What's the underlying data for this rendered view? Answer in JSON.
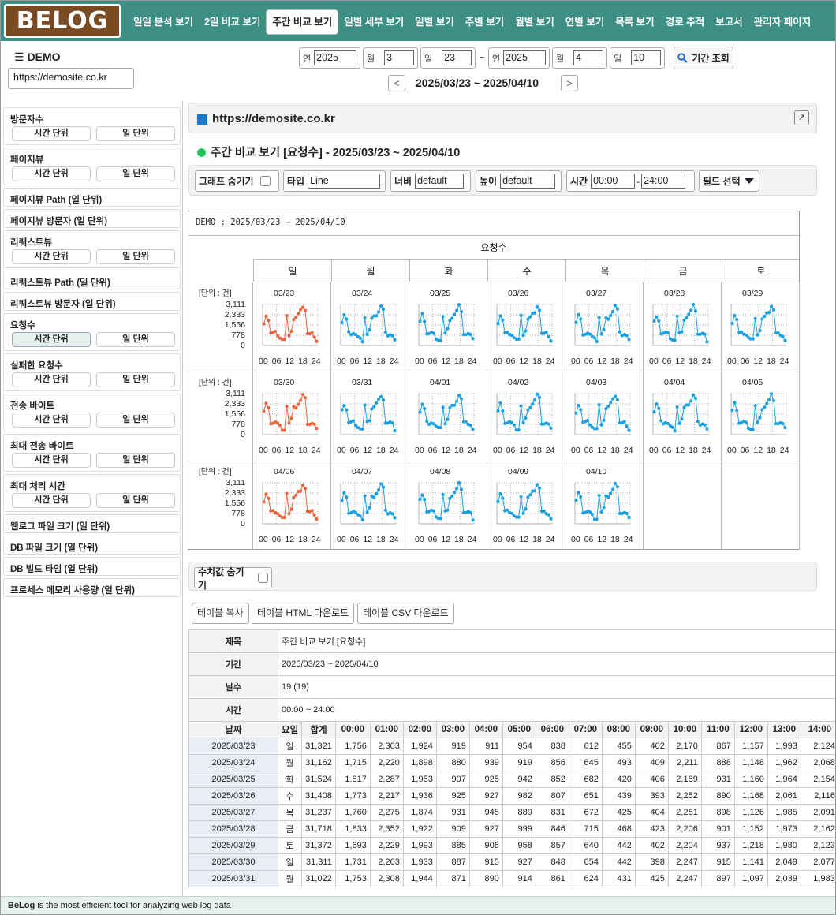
{
  "logo": "BELOG",
  "nav": [
    "일일 분석 보기",
    "2일 비교 보기",
    "주간 비교 보기",
    "일별 세부 보기",
    "일별 보기",
    "주별 보기",
    "월별 보기",
    "연별 보기",
    "목록 보기",
    "경로 추적",
    "보고서",
    "관리자 페이지"
  ],
  "nav_active_index": 2,
  "site": {
    "name": "DEMO",
    "url": "https://demosite.co.kr"
  },
  "date_controls": {
    "from": {
      "year_label": "연",
      "year": "2025",
      "month_label": "월",
      "month": "3",
      "day_label": "일",
      "day": "23"
    },
    "sep": "~",
    "to": {
      "year_label": "연",
      "year": "2025",
      "month_label": "월",
      "month": "4",
      "day_label": "일",
      "day": "10"
    },
    "query_label": "기간 조회",
    "range_text": "2025/03/23 ~ 2025/04/10",
    "prev": "<",
    "next": ">"
  },
  "sidebar": [
    {
      "title": "방문자수",
      "buttons": [
        "시간 단위",
        "일 단위"
      ]
    },
    {
      "title": "페이지뷰",
      "buttons": [
        "시간 단위",
        "일 단위"
      ]
    },
    {
      "title": "페이지뷰 Path  (일 단위)",
      "buttons": []
    },
    {
      "title": "페이지뷰 방문자  (일 단위)",
      "buttons": []
    },
    {
      "title": "리퀘스트뷰",
      "buttons": [
        "시간 단위",
        "일 단위"
      ]
    },
    {
      "title": "리퀘스트뷰 Path  (일 단위)",
      "buttons": []
    },
    {
      "title": "리퀘스트뷰 방문자  (일 단위)",
      "buttons": []
    },
    {
      "title": "요청수",
      "buttons": [
        "시간 단위",
        "일 단위"
      ],
      "active": 0
    },
    {
      "title": "실패한 요청수",
      "buttons": [
        "시간 단위",
        "일 단위"
      ]
    },
    {
      "title": "전송 바이트",
      "buttons": [
        "시간 단위",
        "일 단위"
      ]
    },
    {
      "title": "최대 전송 바이트",
      "buttons": [
        "시간 단위",
        "일 단위"
      ]
    },
    {
      "title": "최대 처리 시간",
      "buttons": [
        "시간 단위",
        "일 단위"
      ]
    },
    {
      "title": "웹로그 파일 크기  (일 단위)",
      "buttons": []
    },
    {
      "title": "DB 파일 크기  (일 단위)",
      "buttons": []
    },
    {
      "title": "DB 빌드 타임  (일 단위)",
      "buttons": []
    },
    {
      "title": "프로세스 메모리 사용량  (일 단위)",
      "buttons": []
    }
  ],
  "main": {
    "site_header": "https://demosite.co.kr",
    "page_title": "주간 비교 보기 [요청수] - 2025/03/23 ~ 2025/04/10",
    "toolbar": {
      "hide_graph": "그래프 숨기기",
      "type_label": "타입",
      "type_value": "Line",
      "width_label": "너비",
      "width_value": "default",
      "height_label": "높이",
      "height_value": "default",
      "time_label": "시간",
      "time_from": "00:00",
      "time_sep": "-",
      "time_to": "24:00",
      "field_select": "필드 선택"
    },
    "hide_values": "수치값 숨기기",
    "buttons": [
      "테이블 복사",
      "테이블 HTML 다운로드",
      "테이블 CSV 다운로드"
    ]
  },
  "chart_grid": {
    "caption": "DEMO : 2025/03/23 ~ 2025/04/10",
    "metric": "요청수",
    "weekdays": [
      "일",
      "월",
      "화",
      "수",
      "목",
      "금",
      "토"
    ],
    "unit": "[단위 : 건]",
    "yticks": [
      "3,111",
      "2,333",
      "1,556",
      "778",
      "0"
    ],
    "xticks": [
      "00",
      "06",
      "12",
      "18",
      "24"
    ],
    "dates": [
      "03/23",
      "03/24",
      "03/25",
      "03/26",
      "03/27",
      "03/28",
      "03/29",
      "03/30",
      "03/31",
      "04/01",
      "04/02",
      "04/03",
      "04/04",
      "04/05",
      "04/06",
      "04/07",
      "04/08",
      "04/09",
      "04/10"
    ],
    "colors": {
      "sunday": "#e8663d",
      "weekday": "#1ba1e2"
    }
  },
  "chart_data": {
    "type": "line",
    "title": "요청수",
    "ylabel": "[단위 : 건]",
    "ylim": [
      0,
      3111
    ],
    "x": [
      "00",
      "01",
      "02",
      "03",
      "04",
      "05",
      "06",
      "07",
      "08",
      "09",
      "10",
      "11",
      "12",
      "13",
      "14",
      "15",
      "16",
      "17",
      "18",
      "19",
      "20",
      "21",
      "22",
      "23"
    ],
    "profile": [
      1756,
      2303,
      1924,
      919,
      911,
      954,
      838,
      612,
      455,
      402,
      2170,
      867,
      1157,
      1993,
      2124,
      2350,
      2600,
      3000,
      2700,
      900,
      850,
      880,
      760,
      400
    ]
  },
  "table": {
    "meta": [
      {
        "label": "제목",
        "value": "주간 비교 보기 [요청수]"
      },
      {
        "label": "기간",
        "value": "2025/03/23 ~ 2025/04/10"
      },
      {
        "label": "날수",
        "value": "19 (19)"
      },
      {
        "label": "시간",
        "value": "00:00 ~ 24:00"
      }
    ],
    "headers": [
      "날짜",
      "요일",
      "합계",
      "00:00",
      "01:00",
      "02:00",
      "03:00",
      "04:00",
      "05:00",
      "06:00",
      "07:00",
      "08:00",
      "09:00",
      "10:00",
      "11:00",
      "12:00",
      "13:00",
      "14:00"
    ],
    "rows": [
      [
        "2025/03/23",
        "일",
        "31,321",
        "1,756",
        "2,303",
        "1,924",
        "919",
        "911",
        "954",
        "838",
        "612",
        "455",
        "402",
        "2,170",
        "867",
        "1,157",
        "1,993",
        "2,124"
      ],
      [
        "2025/03/24",
        "월",
        "31,162",
        "1,715",
        "2,220",
        "1,898",
        "880",
        "939",
        "919",
        "856",
        "645",
        "493",
        "409",
        "2,211",
        "888",
        "1,148",
        "1,962",
        "2,068"
      ],
      [
        "2025/03/25",
        "화",
        "31,524",
        "1,817",
        "2,287",
        "1,953",
        "907",
        "925",
        "942",
        "852",
        "682",
        "420",
        "406",
        "2,189",
        "931",
        "1,160",
        "1,964",
        "2,154"
      ],
      [
        "2025/03/26",
        "수",
        "31,408",
        "1,773",
        "2,217",
        "1,936",
        "925",
        "927",
        "982",
        "807",
        "651",
        "439",
        "393",
        "2,252",
        "890",
        "1,168",
        "2,061",
        "2,116"
      ],
      [
        "2025/03/27",
        "목",
        "31,237",
        "1,760",
        "2,275",
        "1,874",
        "931",
        "945",
        "889",
        "831",
        "672",
        "425",
        "404",
        "2,251",
        "898",
        "1,126",
        "1,985",
        "2,091"
      ],
      [
        "2025/03/28",
        "금",
        "31,718",
        "1,833",
        "2,352",
        "1,922",
        "909",
        "927",
        "999",
        "846",
        "715",
        "468",
        "423",
        "2,206",
        "901",
        "1,152",
        "1,973",
        "2,162"
      ],
      [
        "2025/03/29",
        "토",
        "31,372",
        "1,693",
        "2,229",
        "1,993",
        "885",
        "906",
        "958",
        "857",
        "640",
        "442",
        "402",
        "2,204",
        "937",
        "1,218",
        "1,980",
        "2,123"
      ],
      [
        "2025/03/30",
        "일",
        "31,311",
        "1,731",
        "2,203",
        "1,933",
        "887",
        "915",
        "927",
        "848",
        "654",
        "442",
        "398",
        "2,247",
        "915",
        "1,141",
        "2,049",
        "2,077"
      ],
      [
        "2025/03/31",
        "월",
        "31,022",
        "1,753",
        "2,308",
        "1,944",
        "871",
        "890",
        "914",
        "861",
        "624",
        "431",
        "425",
        "2,247",
        "897",
        "1,097",
        "2,039",
        "1,983"
      ]
    ]
  },
  "footer": {
    "brand": "BeLog",
    "text": " is the most efficient tool for analyzing web log data"
  }
}
